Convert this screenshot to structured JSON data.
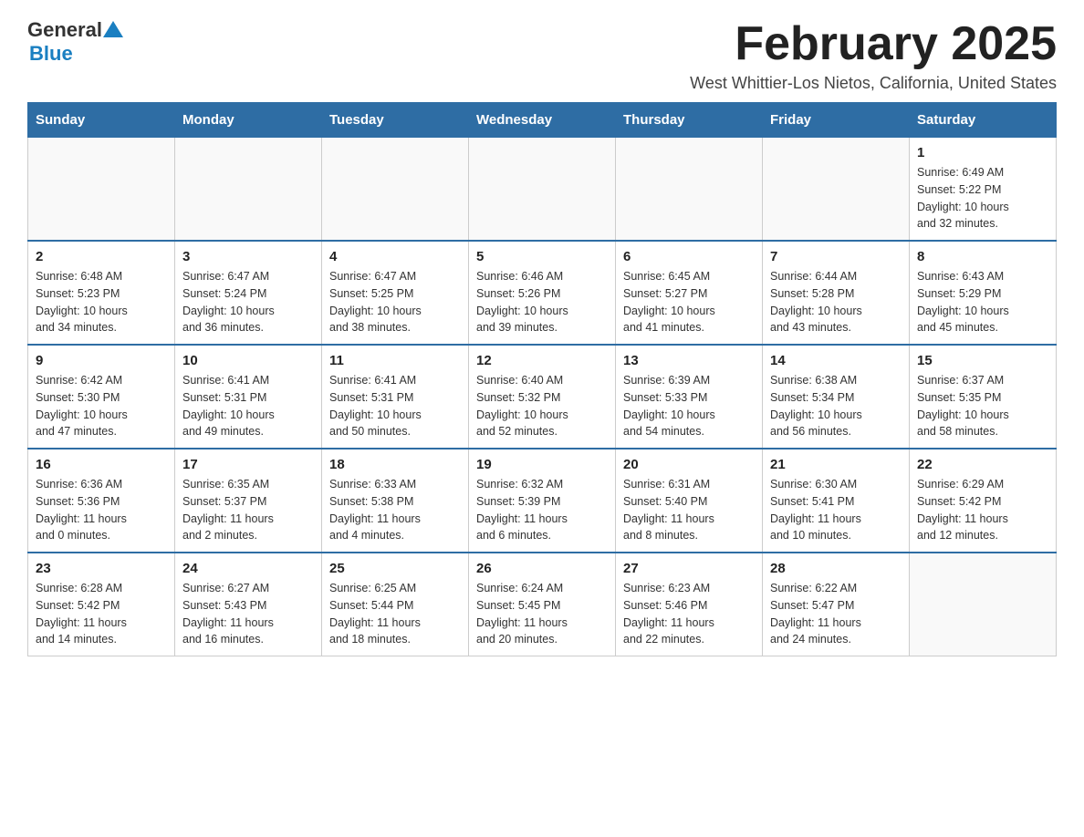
{
  "header": {
    "logo_general": "General",
    "logo_blue": "Blue",
    "month_title": "February 2025",
    "location": "West Whittier-Los Nietos, California, United States"
  },
  "weekdays": [
    "Sunday",
    "Monday",
    "Tuesday",
    "Wednesday",
    "Thursday",
    "Friday",
    "Saturday"
  ],
  "weeks": [
    {
      "days": [
        {
          "num": "",
          "info": ""
        },
        {
          "num": "",
          "info": ""
        },
        {
          "num": "",
          "info": ""
        },
        {
          "num": "",
          "info": ""
        },
        {
          "num": "",
          "info": ""
        },
        {
          "num": "",
          "info": ""
        },
        {
          "num": "1",
          "info": "Sunrise: 6:49 AM\nSunset: 5:22 PM\nDaylight: 10 hours\nand 32 minutes."
        }
      ]
    },
    {
      "days": [
        {
          "num": "2",
          "info": "Sunrise: 6:48 AM\nSunset: 5:23 PM\nDaylight: 10 hours\nand 34 minutes."
        },
        {
          "num": "3",
          "info": "Sunrise: 6:47 AM\nSunset: 5:24 PM\nDaylight: 10 hours\nand 36 minutes."
        },
        {
          "num": "4",
          "info": "Sunrise: 6:47 AM\nSunset: 5:25 PM\nDaylight: 10 hours\nand 38 minutes."
        },
        {
          "num": "5",
          "info": "Sunrise: 6:46 AM\nSunset: 5:26 PM\nDaylight: 10 hours\nand 39 minutes."
        },
        {
          "num": "6",
          "info": "Sunrise: 6:45 AM\nSunset: 5:27 PM\nDaylight: 10 hours\nand 41 minutes."
        },
        {
          "num": "7",
          "info": "Sunrise: 6:44 AM\nSunset: 5:28 PM\nDaylight: 10 hours\nand 43 minutes."
        },
        {
          "num": "8",
          "info": "Sunrise: 6:43 AM\nSunset: 5:29 PM\nDaylight: 10 hours\nand 45 minutes."
        }
      ]
    },
    {
      "days": [
        {
          "num": "9",
          "info": "Sunrise: 6:42 AM\nSunset: 5:30 PM\nDaylight: 10 hours\nand 47 minutes."
        },
        {
          "num": "10",
          "info": "Sunrise: 6:41 AM\nSunset: 5:31 PM\nDaylight: 10 hours\nand 49 minutes."
        },
        {
          "num": "11",
          "info": "Sunrise: 6:41 AM\nSunset: 5:31 PM\nDaylight: 10 hours\nand 50 minutes."
        },
        {
          "num": "12",
          "info": "Sunrise: 6:40 AM\nSunset: 5:32 PM\nDaylight: 10 hours\nand 52 minutes."
        },
        {
          "num": "13",
          "info": "Sunrise: 6:39 AM\nSunset: 5:33 PM\nDaylight: 10 hours\nand 54 minutes."
        },
        {
          "num": "14",
          "info": "Sunrise: 6:38 AM\nSunset: 5:34 PM\nDaylight: 10 hours\nand 56 minutes."
        },
        {
          "num": "15",
          "info": "Sunrise: 6:37 AM\nSunset: 5:35 PM\nDaylight: 10 hours\nand 58 minutes."
        }
      ]
    },
    {
      "days": [
        {
          "num": "16",
          "info": "Sunrise: 6:36 AM\nSunset: 5:36 PM\nDaylight: 11 hours\nand 0 minutes."
        },
        {
          "num": "17",
          "info": "Sunrise: 6:35 AM\nSunset: 5:37 PM\nDaylight: 11 hours\nand 2 minutes."
        },
        {
          "num": "18",
          "info": "Sunrise: 6:33 AM\nSunset: 5:38 PM\nDaylight: 11 hours\nand 4 minutes."
        },
        {
          "num": "19",
          "info": "Sunrise: 6:32 AM\nSunset: 5:39 PM\nDaylight: 11 hours\nand 6 minutes."
        },
        {
          "num": "20",
          "info": "Sunrise: 6:31 AM\nSunset: 5:40 PM\nDaylight: 11 hours\nand 8 minutes."
        },
        {
          "num": "21",
          "info": "Sunrise: 6:30 AM\nSunset: 5:41 PM\nDaylight: 11 hours\nand 10 minutes."
        },
        {
          "num": "22",
          "info": "Sunrise: 6:29 AM\nSunset: 5:42 PM\nDaylight: 11 hours\nand 12 minutes."
        }
      ]
    },
    {
      "days": [
        {
          "num": "23",
          "info": "Sunrise: 6:28 AM\nSunset: 5:42 PM\nDaylight: 11 hours\nand 14 minutes."
        },
        {
          "num": "24",
          "info": "Sunrise: 6:27 AM\nSunset: 5:43 PM\nDaylight: 11 hours\nand 16 minutes."
        },
        {
          "num": "25",
          "info": "Sunrise: 6:25 AM\nSunset: 5:44 PM\nDaylight: 11 hours\nand 18 minutes."
        },
        {
          "num": "26",
          "info": "Sunrise: 6:24 AM\nSunset: 5:45 PM\nDaylight: 11 hours\nand 20 minutes."
        },
        {
          "num": "27",
          "info": "Sunrise: 6:23 AM\nSunset: 5:46 PM\nDaylight: 11 hours\nand 22 minutes."
        },
        {
          "num": "28",
          "info": "Sunrise: 6:22 AM\nSunset: 5:47 PM\nDaylight: 11 hours\nand 24 minutes."
        },
        {
          "num": "",
          "info": ""
        }
      ]
    }
  ]
}
